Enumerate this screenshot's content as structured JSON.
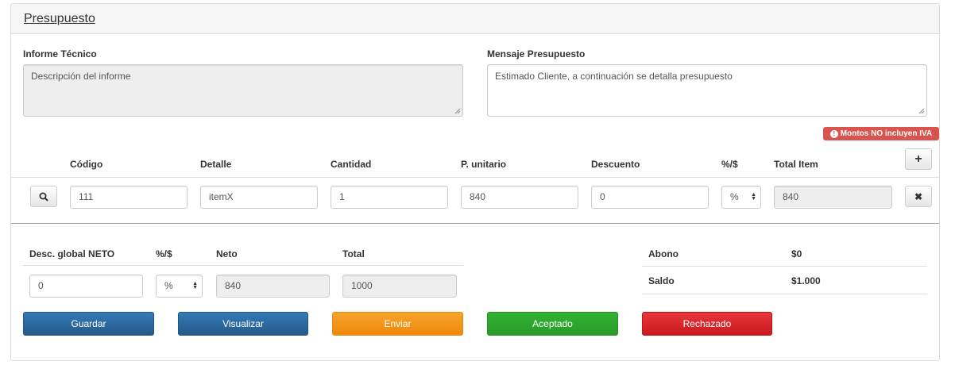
{
  "panel": {
    "title": "Presupuesto"
  },
  "informe": {
    "label": "Informe Técnico",
    "placeholder": "Descripción del informe"
  },
  "mensaje": {
    "label": "Mensaje Presupuesto",
    "value": "Estimado Cliente, a continuación se detalla presupuesto"
  },
  "badge": {
    "text": "Montos NO incluyen IVA",
    "icon": "!"
  },
  "items": {
    "headers": {
      "codigo": "Código",
      "detalle": "Detalle",
      "cantidad": "Cantidad",
      "unitario": "P. unitario",
      "descuento": "Descuento",
      "tipo": "%/$",
      "total": "Total Item"
    },
    "row": {
      "codigo": "111",
      "detalle": "itemX",
      "cantidad": "1",
      "unitario": "840",
      "descuento": "0",
      "tipo": "%",
      "total": "840"
    },
    "add_icon": "+",
    "remove_icon": "✖",
    "search_icon": "search-icon"
  },
  "summary": {
    "headers": {
      "desc": "Desc. global NETO",
      "tipo": "%/$",
      "neto": "Neto",
      "total": "Total"
    },
    "values": {
      "desc": "0",
      "tipo": "%",
      "neto": "840",
      "total": "1000"
    }
  },
  "balance": {
    "abono_label": "Abono",
    "abono_value": "$0",
    "saldo_label": "Saldo",
    "saldo_value": "$1.000"
  },
  "actions": {
    "guardar": "Guardar",
    "visualizar": "Visualizar",
    "enviar": "Enviar",
    "aceptado": "Aceptado",
    "rechazado": "Rechazado"
  },
  "colors": {
    "primary": "#2d6ca8",
    "warning": "#f39a1f",
    "success": "#2ea62f",
    "danger": "#d9272c",
    "badge": "#d9534f"
  }
}
